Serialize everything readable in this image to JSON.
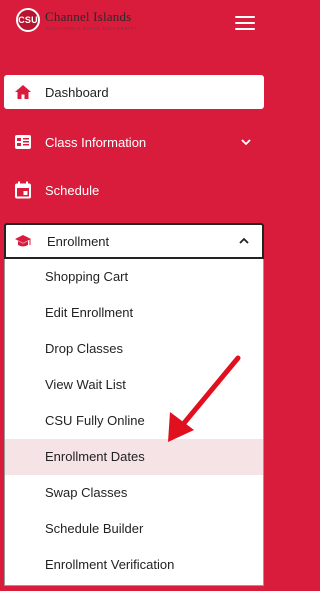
{
  "header": {
    "logo_mark": "CSU",
    "logo_name": "Channel Islands",
    "logo_sub": "CALIFORNIA STATE UNIVERSITY"
  },
  "nav": {
    "dashboard": "Dashboard",
    "class_information": "Class Information",
    "schedule": "Schedule",
    "enrollment": "Enrollment"
  },
  "enrollment_submenu": [
    {
      "label": "Shopping Cart"
    },
    {
      "label": "Edit Enrollment"
    },
    {
      "label": "Drop Classes"
    },
    {
      "label": "View Wait List"
    },
    {
      "label": "CSU Fully Online"
    },
    {
      "label": "Enrollment Dates",
      "selected": true
    },
    {
      "label": "Swap Classes"
    },
    {
      "label": "Schedule Builder"
    },
    {
      "label": "Enrollment Verification"
    }
  ],
  "colors": {
    "brand_red": "#d91c3c",
    "selected_bg": "#f6e3e5",
    "annotation_arrow": "#e0101e"
  }
}
